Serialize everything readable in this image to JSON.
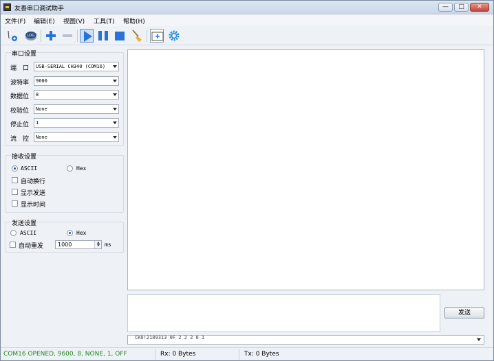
{
  "window": {
    "title": "友善串口调试助手"
  },
  "title_buttons": {
    "minimize": "—",
    "maximize": "□",
    "close": "✕"
  },
  "menu": [
    "文件(F)",
    "编辑(E)",
    "视图(V)",
    "工具(T)",
    "帮助(H)"
  ],
  "toolbar": {
    "log_label": "LOG",
    "icons": [
      "connect-plug-icon",
      "log-icon",
      "add-icon",
      "remove-icon",
      "play-icon",
      "pause-icon",
      "stop-icon",
      "broom-clear-icon",
      "add-window-icon",
      "gear-icon"
    ],
    "accent_color": "#2a73d6"
  },
  "serial_settings": {
    "title": "串口设置",
    "fields": [
      {
        "label": "端　口",
        "value": "USB-SERIAL CH340 (COM16)"
      },
      {
        "label": "波特率",
        "value": "9600"
      },
      {
        "label": "数据位",
        "value": "8"
      },
      {
        "label": "校验位",
        "value": "None"
      },
      {
        "label": "停止位",
        "value": "1"
      },
      {
        "label": "流　控",
        "value": "None"
      }
    ]
  },
  "receive_settings": {
    "title": "接收设置",
    "ascii_label": "ASCII",
    "hex_label": "Hex",
    "selected": "ASCII",
    "options": [
      {
        "label": "自动换行",
        "checked": false
      },
      {
        "label": "显示发送",
        "checked": false
      },
      {
        "label": "显示时间",
        "checked": false
      }
    ]
  },
  "send_settings": {
    "title": "发送设置",
    "ascii_label": "ASCII",
    "hex_label": "Hex",
    "selected": "Hex",
    "auto_resend_label": "自动重发",
    "auto_resend_checked": false,
    "interval_value": "1000",
    "interval_unit": "ms"
  },
  "send_button_label": "发送",
  "history_text": "CK0!2189313 0F 2 2 2 0 1",
  "status": {
    "connection": "COM16 OPENED, 9600, 8, NONE, 1, OFF",
    "connection_color": "#1e8b1e",
    "rx": "Rx: 0 Bytes",
    "tx": "Tx: 0 Bytes"
  }
}
